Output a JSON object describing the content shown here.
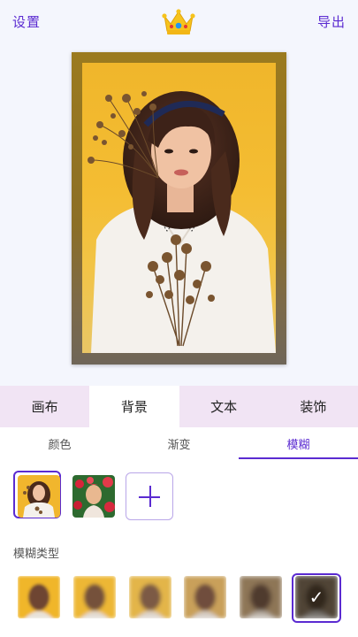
{
  "topbar": {
    "settings_label": "设置",
    "export_label": "导出",
    "crown_icon": "crown-icon"
  },
  "tabs": [
    {
      "label": "画布",
      "active": false
    },
    {
      "label": "背景",
      "active": true
    },
    {
      "label": "文本",
      "active": false
    },
    {
      "label": "装饰",
      "active": false
    }
  ],
  "subtabs": [
    {
      "label": "颜色",
      "active": false
    },
    {
      "label": "渐变",
      "active": false
    },
    {
      "label": "模糊",
      "active": true
    }
  ],
  "blur_section": {
    "label": "模糊类型",
    "selected_index": 5,
    "option_count": 6
  },
  "colors": {
    "accent": "#5b2bd1",
    "tab_bar_bg": "#f1e4f4",
    "photo_yellow": "#f2b92c"
  }
}
